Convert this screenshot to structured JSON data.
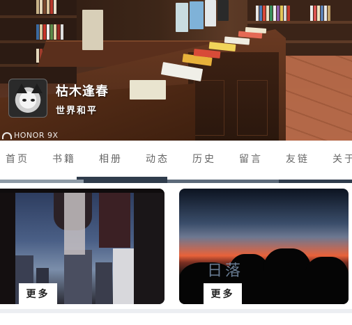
{
  "hero": {
    "site_name": "枯木逢春",
    "tagline": "世界和平",
    "watermark": "HONOR 9X",
    "avatar": "cat-avatar"
  },
  "nav": {
    "items": [
      {
        "label": "首页"
      },
      {
        "label": "书籍"
      },
      {
        "label": "相册"
      },
      {
        "label": "动态"
      },
      {
        "label": "历史"
      },
      {
        "label": "留言"
      },
      {
        "label": "友链"
      },
      {
        "label": "关于"
      }
    ]
  },
  "cards": [
    {
      "more_label": "更多",
      "image": "laundry-window-city-photo"
    },
    {
      "more_label": "更多",
      "image": "sunset-photo",
      "overlay_text": "日落"
    }
  ],
  "colors": {
    "nav_text": "#666666",
    "divider": "#2f3c4c",
    "divider_light": "#8e9aa6"
  }
}
